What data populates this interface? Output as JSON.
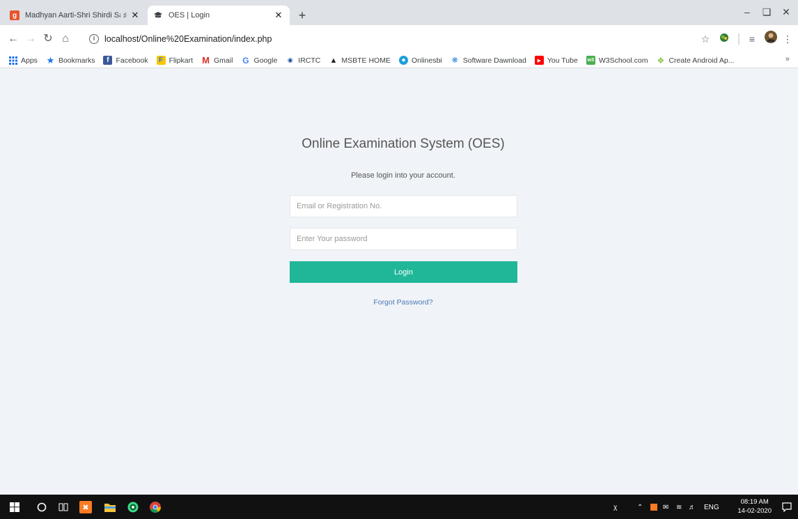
{
  "tabs": [
    {
      "title": "Madhyan Aarti-Shri Shirdi Sa",
      "favicon_letter": "g"
    },
    {
      "title": "OES | Login"
    }
  ],
  "browser": {
    "url": "localhost/Online%20Examination/index.php"
  },
  "bookmarks": [
    {
      "label": "Apps",
      "icon": "apps-grid-icon"
    },
    {
      "label": "Bookmarks",
      "icon": "star-icon"
    },
    {
      "label": "Facebook",
      "icon": "facebook-icon"
    },
    {
      "label": "Flipkart",
      "icon": "flipkart-icon"
    },
    {
      "label": "Gmail",
      "icon": "gmail-icon"
    },
    {
      "label": "Google",
      "icon": "google-icon"
    },
    {
      "label": "IRCTC",
      "icon": "irctc-icon"
    },
    {
      "label": "MSBTE HOME",
      "icon": "msbte-icon"
    },
    {
      "label": "Onlinesbi",
      "icon": "sbi-icon"
    },
    {
      "label": "Software Dawnload",
      "icon": "software-icon"
    },
    {
      "label": "You Tube",
      "icon": "youtube-icon"
    },
    {
      "label": "W3School.com",
      "icon": "w3school-icon"
    },
    {
      "label": "Create Android Ap...",
      "icon": "android-icon"
    }
  ],
  "login": {
    "title": "Online Examination System (OES)",
    "subtitle": "Please login into your account.",
    "email_placeholder": "Email or Registration No.",
    "password_placeholder": "Enter Your password",
    "button_label": "Login",
    "forgot_label": "Forgot Password?"
  },
  "taskbar": {
    "language": "ENG",
    "time": "08:19 AM",
    "date": "14-02-2020"
  },
  "colors": {
    "accent": "#20b799",
    "link": "#4a78b5",
    "page_bg": "#f0f3f8"
  }
}
